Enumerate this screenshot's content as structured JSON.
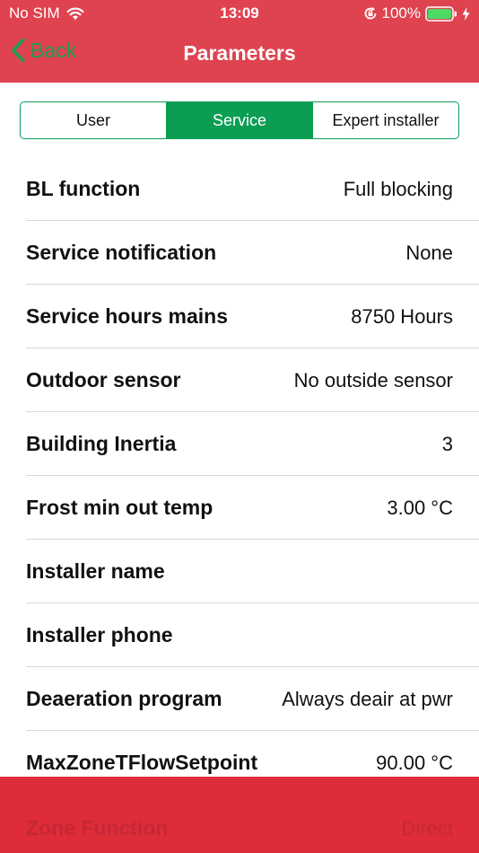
{
  "status_bar": {
    "carrier": "No SIM",
    "time": "13:09",
    "battery": "100%"
  },
  "nav": {
    "back_label": "Back",
    "title": "Parameters"
  },
  "tabs": [
    {
      "label": "User",
      "active": false
    },
    {
      "label": "Service",
      "active": true
    },
    {
      "label": "Expert installer",
      "active": false
    }
  ],
  "rows": [
    {
      "label": "BL function",
      "value": "Full blocking"
    },
    {
      "label": "Service notification",
      "value": "None"
    },
    {
      "label": "Service hours mains",
      "value": "8750 Hours"
    },
    {
      "label": "Outdoor sensor",
      "value": "No outside sensor"
    },
    {
      "label": "Building Inertia",
      "value": "3"
    },
    {
      "label": "Frost min out temp",
      "value": "3.00 °C"
    },
    {
      "label": "Installer name",
      "value": ""
    },
    {
      "label": "Installer phone",
      "value": ""
    },
    {
      "label": "Deaeration program",
      "value": "Always deair at pwr"
    },
    {
      "label": "MaxZoneTFlowSetpoint",
      "value": "90.00 °C"
    }
  ],
  "bottom_row": {
    "label": "Zone Function",
    "value": "Direct"
  },
  "colors": {
    "header": "#df4350",
    "accent": "#0c9d55",
    "back": "#1a9e55",
    "bottom_bar": "#de2c38"
  }
}
